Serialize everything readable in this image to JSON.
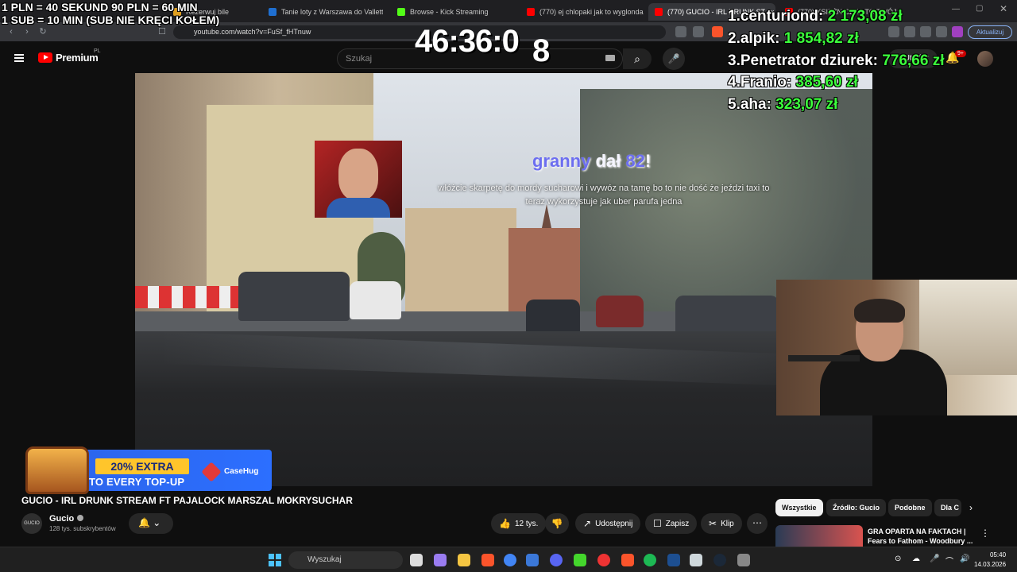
{
  "browser": {
    "tabs": [
      {
        "label": "Rezerwuj bile",
        "color": "#e0a020"
      },
      {
        "label": "Tanie loty z Warszawa do Valletta w",
        "color": "#1f6fd1"
      },
      {
        "label": "Browse - Kick Streaming",
        "color": "#53fc18"
      },
      {
        "label": "(770) ej chlopaki jak to wyglonda - Y",
        "color": "#ff0000"
      },
      {
        "label": "(770) GUCIO - IRL DRUNK ST",
        "color": "#ff0000"
      },
      {
        "label": "(770) KSIĘŻNICZKA TO TWÓJ NAJ",
        "color": "#ff0000"
      }
    ],
    "url": "youtube.com/watch?v=FuSf_fHTnuw",
    "update_label": "Aktualizuj"
  },
  "youtube": {
    "brand": "Premium",
    "country": "PL",
    "search_placeholder": "Szukaj",
    "create_label": "+ Utwórz",
    "notif_count": "9+"
  },
  "overlay": {
    "rule1": "1 PLN =  40 SEKUND 90 PLN = 60 MIN",
    "rule2": "1 SUB = 10 MIN (SUB NIE KRĘCI KOŁEM)",
    "timer": "46:36:0",
    "timer_tail": "8",
    "leaderboard": [
      {
        "rank": "1.",
        "name": "centuriond:",
        "amount": "2 173,08 zł"
      },
      {
        "rank": "2.",
        "name": "alpik:",
        "amount": "1 854,82 zł"
      },
      {
        "rank": "3.",
        "name": "Penetrator dziurek:",
        "amount": "776,66 zł"
      },
      {
        "rank": "4.",
        "name": "Franio:",
        "amount": "385,60 zł"
      },
      {
        "rank": "5.",
        "name": "aha:",
        "amount": "323,07 zł"
      }
    ],
    "donation": {
      "name": "granny",
      "verb": "dał",
      "amount": "82",
      "message": "włóżcie skarpetę do mordy sucharowi i wywóz na tamę bo to nie dość że jeździ taxi to teraz wykorzystuje jak uber parufa jedna"
    }
  },
  "sponsor": {
    "extra": "20% EXTRA",
    "line": "TO EVERY TOP-UP",
    "brand": "CaseHug"
  },
  "video": {
    "title": "GUCIO - IRL DRUNK STREAM FT PAJALOCK MARSZAL MOKRYSUCHAR",
    "channel_avatar": "GUCIO",
    "channel": "Gucio",
    "subscribers": "128 tys. subskrybentów",
    "likes": "12 tys.",
    "share": "Udostępnij",
    "save": "Zapisz",
    "clip": "Klip"
  },
  "sidebar": {
    "chips": [
      "Wszystkie",
      "Źródło: Gucio",
      "Podobne",
      "Dla C"
    ],
    "rec_title": "GRA OPARTA NA FAKTACH | Fears to Fathom - Woodbury ..."
  },
  "taskbar": {
    "search_placeholder": "Wyszukaj",
    "time": "05:40",
    "date": "14.03.2026"
  }
}
